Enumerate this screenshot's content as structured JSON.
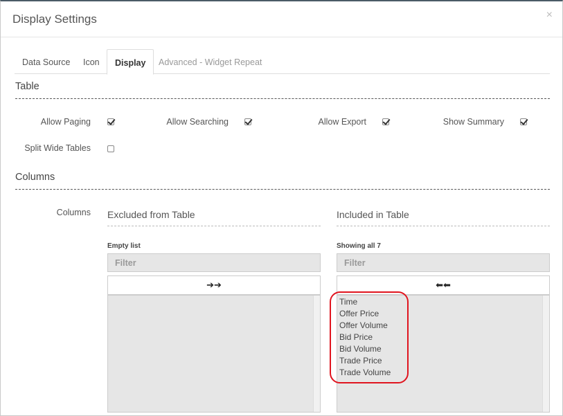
{
  "modal": {
    "title": "Display Settings",
    "close": "×"
  },
  "tabs": [
    {
      "label": "Data Source",
      "state": "normal"
    },
    {
      "label": "Icon",
      "state": "normal"
    },
    {
      "label": "Display",
      "state": "active"
    },
    {
      "label": "Advanced - Widget Repeat",
      "state": "disabled"
    }
  ],
  "table_section": {
    "title": "Table",
    "options": [
      {
        "label": "Allow Paging",
        "checked": true
      },
      {
        "label": "Allow Searching",
        "checked": true
      },
      {
        "label": "Allow Export",
        "checked": true
      },
      {
        "label": "Show Summary",
        "checked": true
      },
      {
        "label": "Split Wide Tables",
        "checked": false
      }
    ]
  },
  "columns_section": {
    "title": "Columns",
    "field_label": "Columns",
    "excluded": {
      "header": "Excluded from Table",
      "info": "Empty list",
      "filter_placeholder": "Filter",
      "move_button": "➔➔",
      "items": []
    },
    "included": {
      "header": "Included in Table",
      "info": "Showing all 7",
      "filter_placeholder": "Filter",
      "move_button": "⬅⬅",
      "items": [
        "Time",
        "Offer Price",
        "Offer Volume",
        "Bid Price",
        "Bid Volume",
        "Trade Price",
        "Trade Volume"
      ]
    }
  },
  "colors": {
    "annotation": "#e0141e",
    "header_bar": "#4a5a66"
  }
}
